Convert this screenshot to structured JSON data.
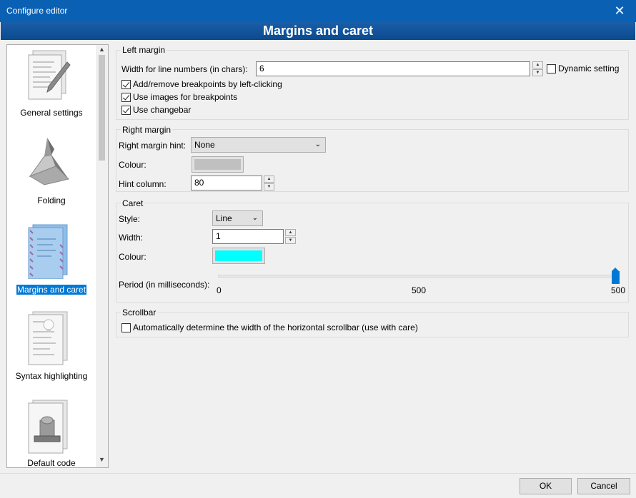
{
  "window": {
    "title": "Configure editor",
    "close_glyph": "✕"
  },
  "header": {
    "title": "Margins and caret"
  },
  "sidebar": {
    "items": [
      {
        "label": "General settings",
        "icon": "general-settings-icon"
      },
      {
        "label": "Folding",
        "icon": "folding-icon"
      },
      {
        "label": "Margins and caret",
        "icon": "margins-caret-icon",
        "selected": true
      },
      {
        "label": "Syntax highlighting",
        "icon": "syntax-highlighting-icon"
      },
      {
        "label": "Default code",
        "icon": "default-code-icon"
      }
    ]
  },
  "left_margin": {
    "title": "Left margin",
    "line_numbers_label": "Width for line numbers (in chars):",
    "line_numbers_value": "6",
    "dynamic_label": "Dynamic setting",
    "dynamic_checked": false,
    "breakpoints_label": "Add/remove breakpoints by left-clicking",
    "breakpoints_checked": true,
    "images_label": "Use images for breakpoints",
    "images_checked": true,
    "changebar_label": "Use changebar",
    "changebar_checked": true
  },
  "right_margin": {
    "title": "Right margin",
    "hint_label": "Right margin hint:",
    "hint_value": "None",
    "colour_label": "Colour:",
    "colour": "#c0c0c0",
    "column_label": "Hint column:",
    "column_value": "80"
  },
  "caret": {
    "title": "Caret",
    "style_label": "Style:",
    "style_value": "Line",
    "width_label": "Width:",
    "width_value": "1",
    "colour_label": "Colour:",
    "colour": "#00ffff",
    "period_label": "Period (in milliseconds):",
    "period_min": "0",
    "period_mid": "500",
    "period_max": "500",
    "period_level": 1.0
  },
  "scrollbar": {
    "title": "Scrollbar",
    "auto_label": "Automatically determine the width of the horizontal scrollbar (use with care)",
    "auto_checked": false
  },
  "buttons": {
    "ok": "OK",
    "cancel": "Cancel"
  },
  "colors": {
    "titlebar": "#0a61b4",
    "accent": "#0078d7"
  }
}
